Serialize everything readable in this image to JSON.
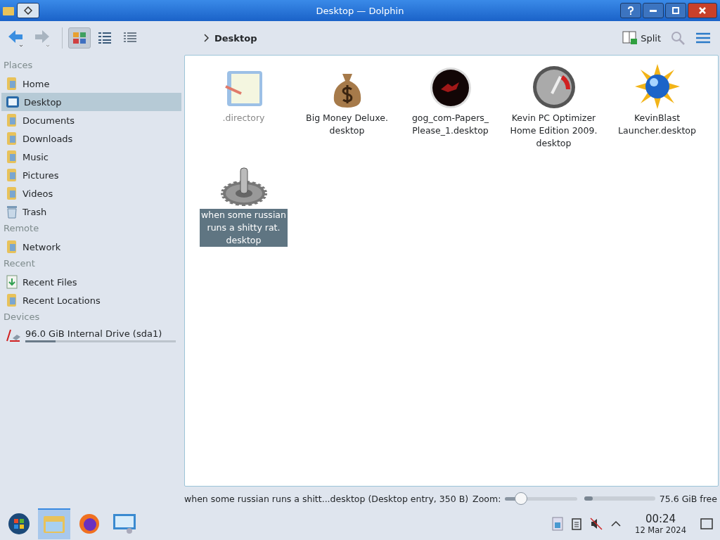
{
  "window": {
    "title": "Desktop — Dolphin"
  },
  "toolbar": {
    "view_modes": [
      {
        "kind": "icons",
        "selected": true
      },
      {
        "kind": "compact",
        "selected": false
      },
      {
        "kind": "details",
        "selected": false
      }
    ],
    "breadcrumb": "Desktop",
    "split": "Split"
  },
  "sidebar": [
    {
      "heading": "Places",
      "items": [
        {
          "label": "Home",
          "kind": "folder",
          "selected": false
        },
        {
          "label": "Desktop",
          "kind": "desktop",
          "selected": true
        },
        {
          "label": "Documents",
          "kind": "folder",
          "selected": false
        },
        {
          "label": "Downloads",
          "kind": "folder",
          "selected": false
        },
        {
          "label": "Music",
          "kind": "folder",
          "selected": false
        },
        {
          "label": "Pictures",
          "kind": "folder",
          "selected": false
        },
        {
          "label": "Videos",
          "kind": "folder",
          "selected": false
        },
        {
          "label": "Trash",
          "kind": "trash",
          "selected": false
        }
      ]
    },
    {
      "heading": "Remote",
      "items": [
        {
          "label": "Network",
          "kind": "folder",
          "selected": false
        }
      ]
    },
    {
      "heading": "Recent",
      "items": [
        {
          "label": "Recent Files",
          "kind": "recent",
          "selected": false
        },
        {
          "label": "Recent Locations",
          "kind": "folder",
          "selected": false
        }
      ]
    },
    {
      "heading": "Devices",
      "items": [
        {
          "label": "96.0 GiB Internal Drive (sda1)",
          "kind": "drive",
          "selected": false,
          "level": 0.2
        }
      ]
    }
  ],
  "files": [
    {
      "name": ".directory",
      "kind": "document",
      "hidden": true,
      "selected": false
    },
    {
      "name": "Big Money Deluxe.\ndesktop",
      "kind": "money",
      "hidden": false,
      "selected": false
    },
    {
      "name": "gog_com-Papers_\nPlease_1.desktop",
      "kind": "disc",
      "hidden": false,
      "selected": false
    },
    {
      "name": "Kevin PC Optimizer\nHome Edition 2009.\ndesktop",
      "kind": "gauge",
      "hidden": false,
      "selected": false
    },
    {
      "name": "KevinBlast\nLauncher.desktop",
      "kind": "globe",
      "hidden": false,
      "selected": false
    },
    {
      "name": "when some russian\nruns a shitty rat.\ndesktop",
      "kind": "gear",
      "hidden": false,
      "selected": true
    }
  ],
  "status": {
    "text": "when some russian runs a shitt...desktop (Desktop entry, 350 B)",
    "zoom_label": "Zoom:",
    "zoom": {
      "level": 0.17
    },
    "space": {
      "level": 0.12
    },
    "free": "75.6 GiB free"
  },
  "taskbar": {
    "apps": [
      {
        "kind": "start",
        "selected": false
      },
      {
        "kind": "files",
        "selected": true
      },
      {
        "kind": "browser",
        "selected": false
      },
      {
        "kind": "settings",
        "selected": false
      }
    ],
    "time": "00:24",
    "date": "12 Mar 2024"
  }
}
